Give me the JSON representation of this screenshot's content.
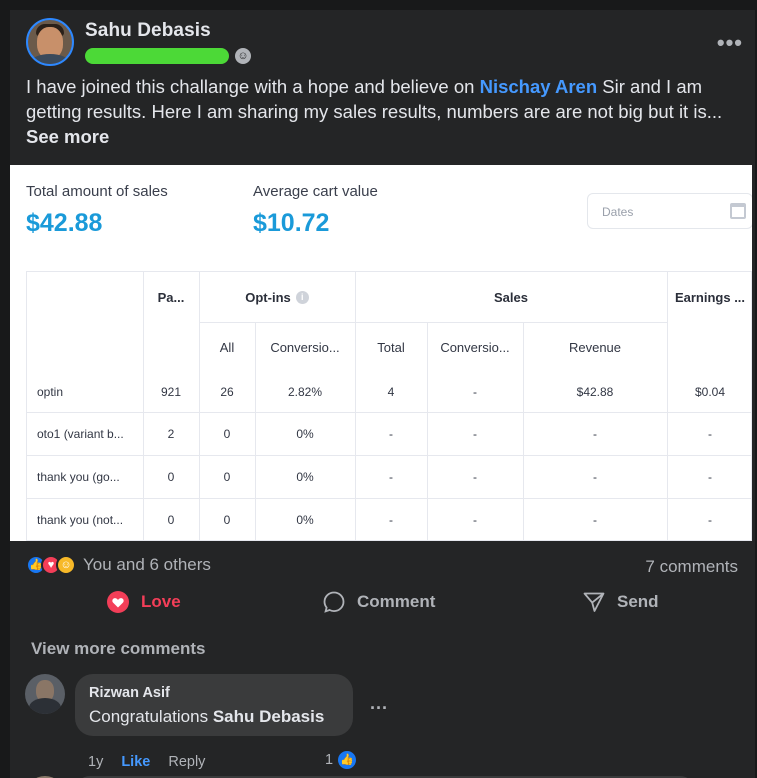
{
  "post": {
    "author": "Sahu Debasis",
    "text_before_mention": "I have joined this challange with a hope and believe on ",
    "mention": "Nischay Aren",
    "text_after_mention": " Sir and I am getting results. Here I am sharing my sales results, numbers are are not big but it is...",
    "see_more": "See more",
    "more_icon": "more-dots-icon",
    "privacy_icon": "friends-icon"
  },
  "screenshot": {
    "total_sales_label": "Total amount of sales",
    "total_sales_value": "$42.88",
    "avg_cart_label": "Average cart value",
    "avg_cart_value": "$10.72",
    "dates_placeholder": "Dates",
    "accent_color": "#1a9ad9",
    "table": {
      "group_headers": [
        "Pa...",
        "Opt-ins",
        "Sales",
        "Earnings ..."
      ],
      "sub_headers": [
        "All",
        "Conversio...",
        "Total",
        "Conversio...",
        "Revenue"
      ],
      "rows": [
        [
          "optin",
          "921",
          "26",
          "2.82%",
          "4",
          "-",
          "$42.88",
          "$0.04"
        ],
        [
          "oto1 (variant b...",
          "2",
          "0",
          "0%",
          "-",
          "-",
          "-",
          "-"
        ],
        [
          "thank you (go...",
          "0",
          "0",
          "0%",
          "-",
          "-",
          "-",
          "-"
        ],
        [
          "thank you (not...",
          "0",
          "0",
          "0%",
          "-",
          "-",
          "-",
          "-"
        ]
      ]
    }
  },
  "reactions": {
    "summary": "You and 6 others",
    "comments_count": "7 comments",
    "icons": [
      "like-icon",
      "love-icon",
      "care-icon"
    ]
  },
  "actions": {
    "love": "Love",
    "comment": "Comment",
    "send": "Send"
  },
  "comments": {
    "view_more": "View more comments",
    "items": [
      {
        "author": "Rizwan Asif",
        "text": "Congratulations ",
        "mention": "Sahu Debasis",
        "age": "1y",
        "like": "Like",
        "reply": "Reply",
        "likes": "1"
      }
    ]
  },
  "colors": {
    "background": "#18191a",
    "card": "#242526",
    "link": "#4599ff",
    "love": "#f33e58"
  }
}
